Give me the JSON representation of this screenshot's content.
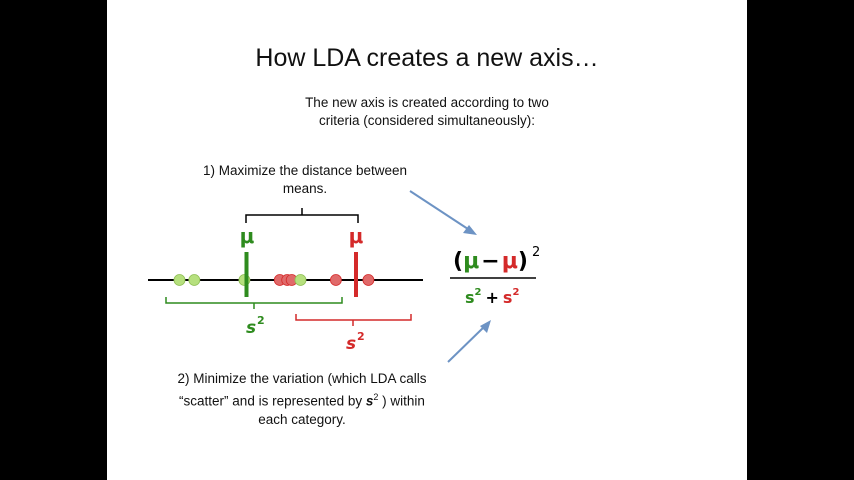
{
  "slide": {
    "title": "How LDA creates a new axis…",
    "subtitle_line1": "The new axis is created according to two",
    "subtitle_line2": "criteria (considered simultaneously):",
    "criterion1_line1": "1) Maximize the distance between",
    "criterion1_line2": "means.",
    "criterion2_line1": "2) Minimize the variation (which LDA calls",
    "criterion2_line2_pre": "“scatter” and is represented by ",
    "criterion2_symbol": "s",
    "criterion2_exp": "2",
    "criterion2_line2_post": " ) within",
    "criterion2_line3": "each category."
  },
  "diagram": {
    "mu": "μ",
    "s": "s",
    "exp": "2",
    "minus": "−",
    "plus": "+",
    "open_paren": "(",
    "close_paren": ")",
    "colors": {
      "green": "#2e8b1e",
      "light_green": "#b6e07e",
      "red": "#d42a2a",
      "light_red": "#e06a6a",
      "arrow": "#6d93c4",
      "axis": "#000000"
    },
    "green_points": [
      0.9,
      1.4,
      3.1,
      5.0
    ],
    "red_points": [
      4.3,
      4.55,
      4.7,
      6.2,
      7.3
    ],
    "green_mean": 2.4,
    "red_mean": 5.4
  }
}
